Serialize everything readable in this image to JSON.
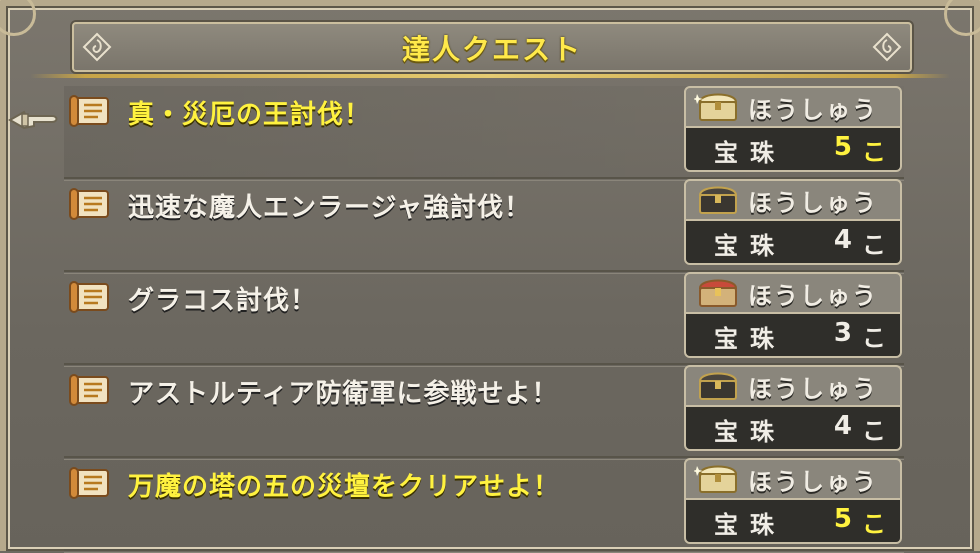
{
  "header": {
    "title": "達人クエスト"
  },
  "quests": [
    {
      "name": "真・災厄の王討伐！",
      "highlight": true,
      "chest": "gold",
      "reward_label": "ほうしゅう",
      "item": "宝珠",
      "count": "5",
      "unit": "こ"
    },
    {
      "name": "迅速な魔人エンラージャ強討伐！",
      "highlight": false,
      "chest": "black",
      "reward_label": "ほうしゅう",
      "item": "宝珠",
      "count": "4",
      "unit": "こ"
    },
    {
      "name": "グラコス討伐！",
      "highlight": false,
      "chest": "red",
      "reward_label": "ほうしゅう",
      "item": "宝珠",
      "count": "3",
      "unit": "こ"
    },
    {
      "name": "アストルティア防衛軍に参戦せよ！",
      "highlight": false,
      "chest": "black",
      "reward_label": "ほうしゅう",
      "item": "宝珠",
      "count": "4",
      "unit": "こ"
    },
    {
      "name": "万魔の塔の五の災壇をクリアせよ！",
      "highlight": true,
      "chest": "gold",
      "reward_label": "ほうしゅう",
      "item": "宝珠",
      "count": "5",
      "unit": "こ"
    }
  ],
  "colors": {
    "highlight": "#fff23f",
    "normal": "#f5f1e8",
    "chest_gold": "#d9c27a",
    "chest_black": "#3a3630",
    "chest_red": "#c84a3a"
  },
  "icons": {
    "quest": "scroll-icon",
    "cursor": "pointing-hand-cursor-icon"
  }
}
